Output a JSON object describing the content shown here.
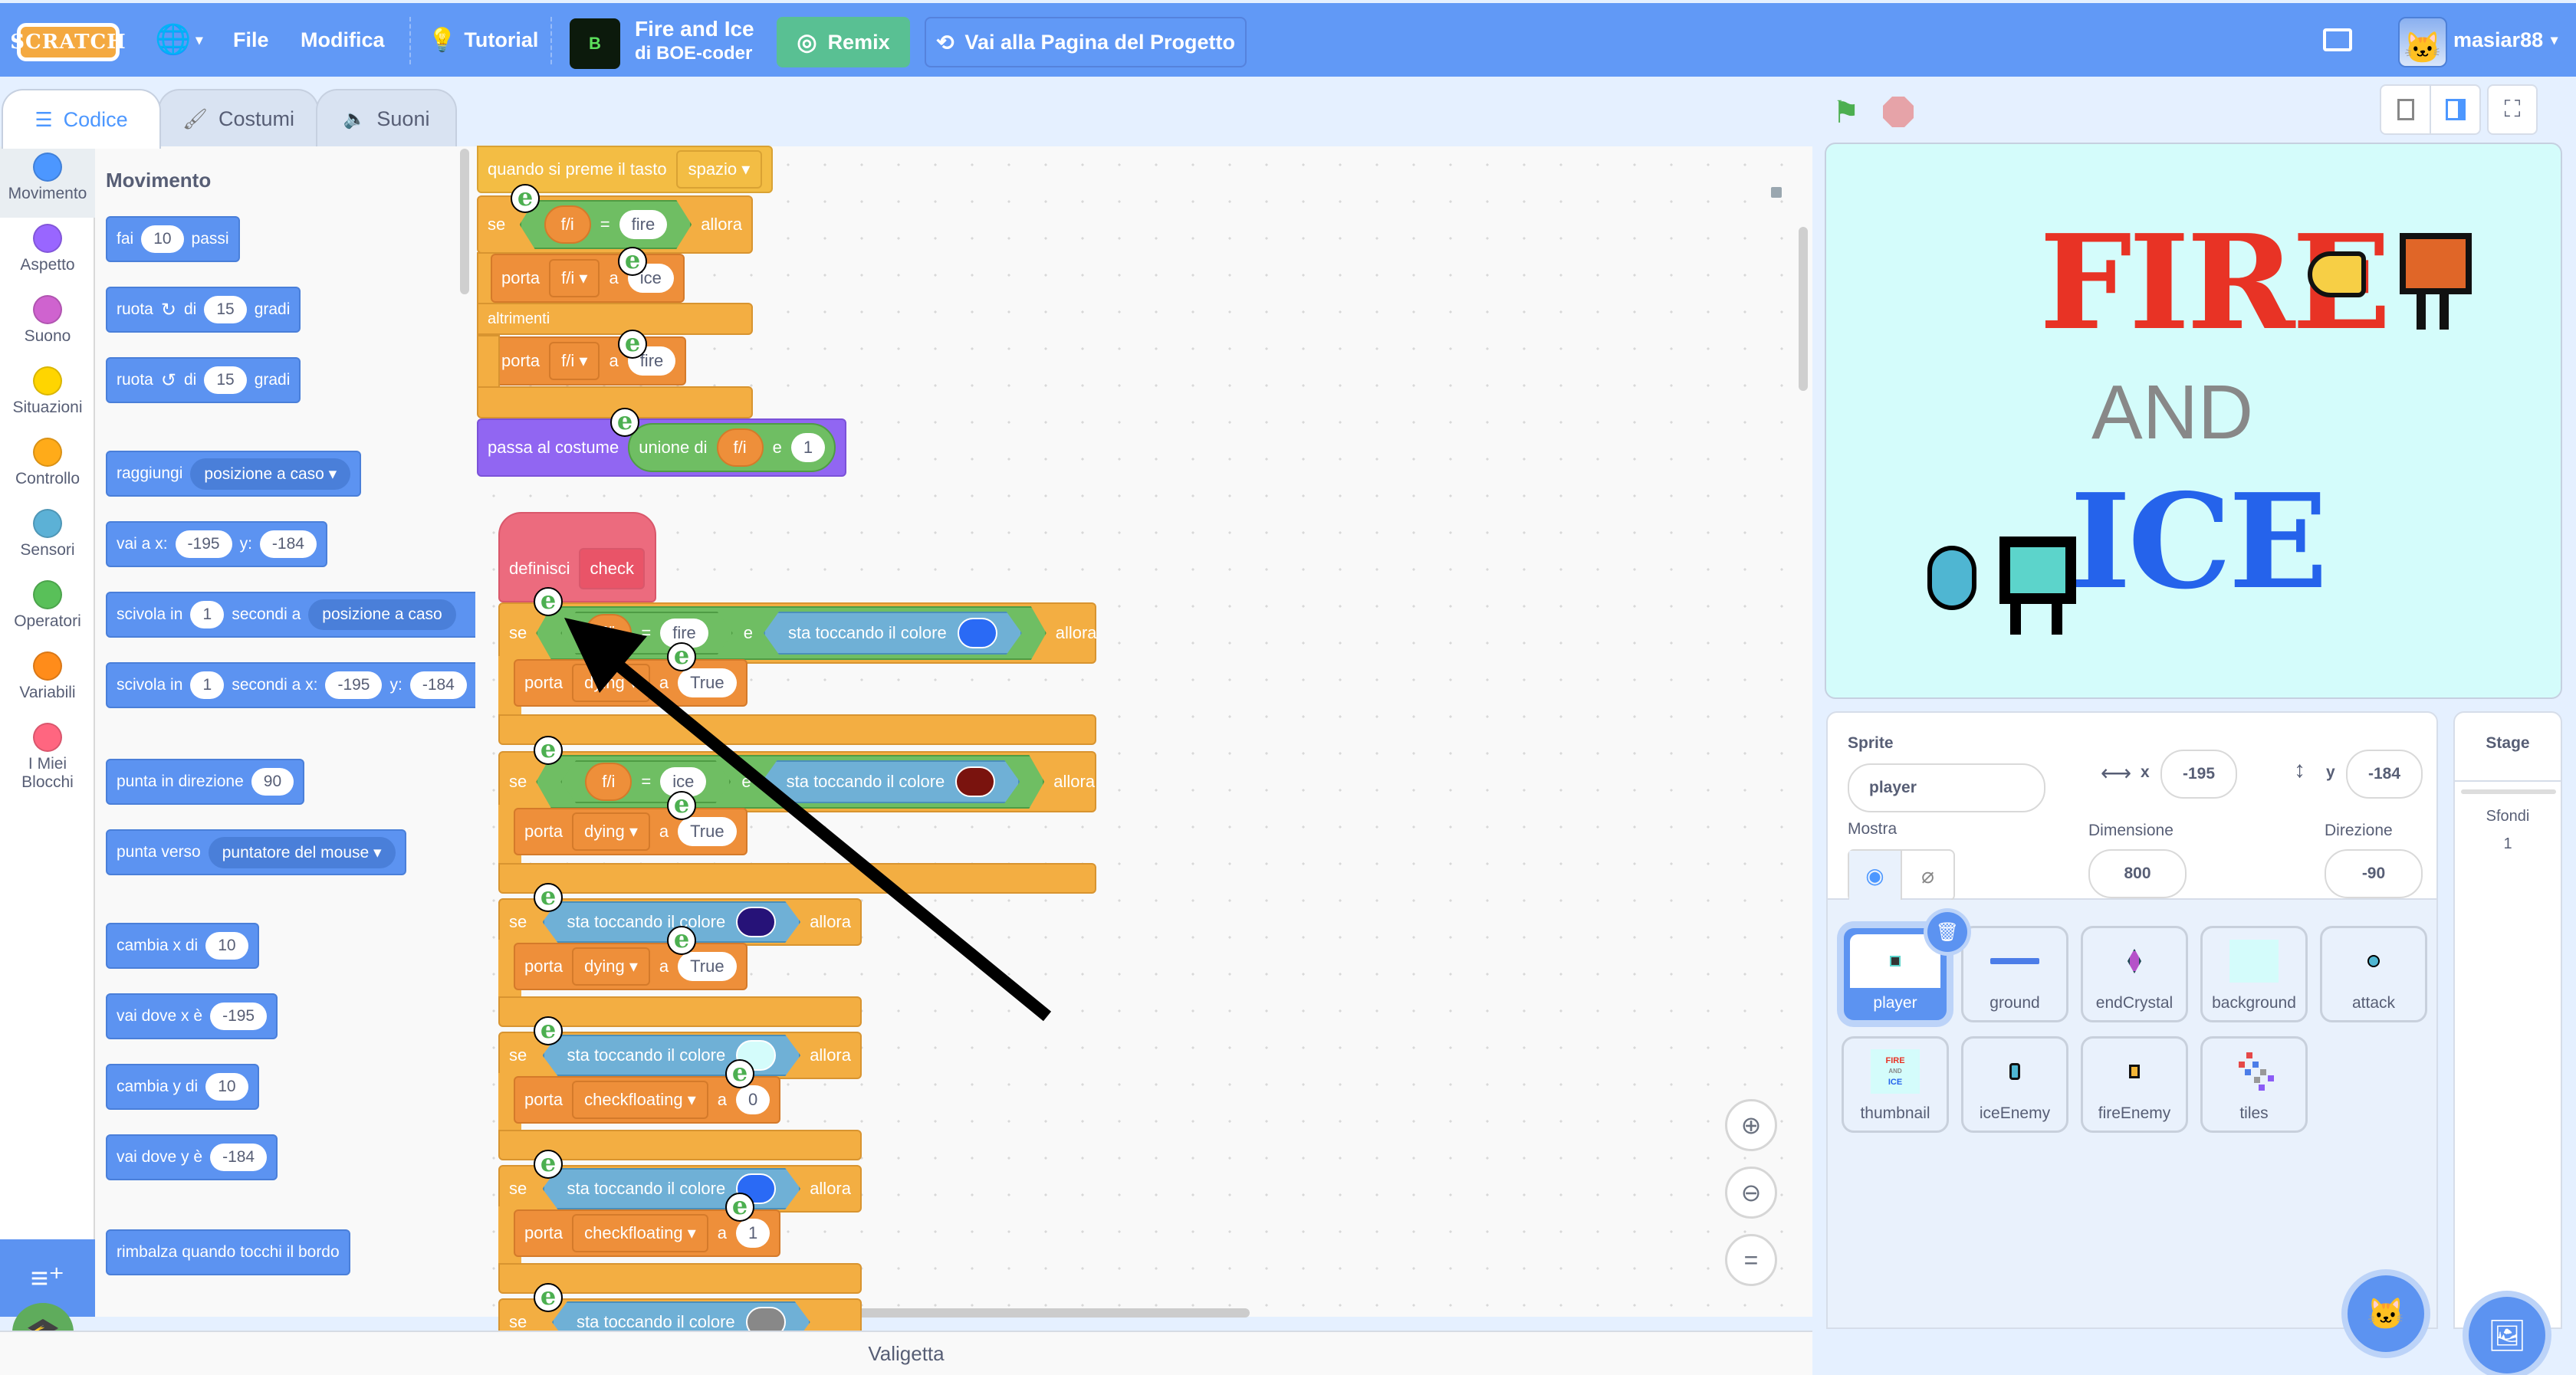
{
  "menubar": {
    "logo": "SCRATCH",
    "language_icon": "globe-icon",
    "file": "File",
    "edit": "Modifica",
    "tutorial": "Tutorial",
    "project_thumb_letter": "B",
    "project_title": "Fire and Ice",
    "project_author": "di BOE-coder",
    "remix": "Remix",
    "project_page": "Vai alla Pagina del Progetto",
    "username": "masiar88"
  },
  "tabs": {
    "code": "Codice",
    "costumes": "Costumi",
    "sounds": "Suoni"
  },
  "categories": [
    {
      "label": "Movimento",
      "color": "#4c97ff"
    },
    {
      "label": "Aspetto",
      "color": "#9966ff"
    },
    {
      "label": "Suono",
      "color": "#cf63cf"
    },
    {
      "label": "Situazioni",
      "color": "#ffd500"
    },
    {
      "label": "Controllo",
      "color": "#ffab19"
    },
    {
      "label": "Sensori",
      "color": "#5cb1d6"
    },
    {
      "label": "Operatori",
      "color": "#59c059"
    },
    {
      "label": "Variabili",
      "color": "#ff8c1a"
    },
    {
      "label": "I Miei Blocchi",
      "color": "#ff6680"
    }
  ],
  "palette": {
    "title": "Movimento",
    "blocks": {
      "move": {
        "pre": "fai",
        "val": "10",
        "post": "passi"
      },
      "turn_right": {
        "pre": "ruota",
        "mid": "di",
        "val": "15",
        "post": "gradi"
      },
      "turn_left": {
        "pre": "ruota",
        "mid": "di",
        "val": "15",
        "post": "gradi"
      },
      "goto": {
        "pre": "raggiungi",
        "dd": "posizione a caso"
      },
      "goto_xy": {
        "pre": "vai a x:",
        "x": "-195",
        "ylbl": "y:",
        "y": "-184"
      },
      "glide": {
        "pre": "scivola in",
        "val": "1",
        "mid": "secondi a",
        "dd": "posizione a caso"
      },
      "glide_xy": {
        "pre": "scivola in",
        "val": "1",
        "mid": "secondi a x:",
        "x": "-195",
        "ylbl": "y:",
        "y": "-184"
      },
      "point_dir": {
        "pre": "punta in direzione",
        "val": "90"
      },
      "point_towards": {
        "pre": "punta verso",
        "dd": "puntatore del mouse"
      },
      "change_x": {
        "pre": "cambia x di",
        "val": "10"
      },
      "set_x": {
        "pre": "vai dove x è",
        "val": "-195"
      },
      "change_y": {
        "pre": "cambia y di",
        "val": "10"
      },
      "set_y": {
        "pre": "vai dove y è",
        "val": "-184"
      },
      "bounce": {
        "pre": "rimbalza quando tocchi il bordo"
      }
    }
  },
  "script1": {
    "hat": {
      "label": "quando si preme il tasto",
      "key": "spazio"
    },
    "if": {
      "se": "se",
      "var": "f/i",
      "eq": "=",
      "val": "fire",
      "then": "allora"
    },
    "set1": {
      "porta": "porta",
      "var": "f/i",
      "a": "a",
      "val": "ice"
    },
    "else": "altrimenti",
    "set2": {
      "porta": "porta",
      "var": "f/i",
      "a": "a",
      "val": "fire"
    },
    "costume": {
      "label": "passa al costume",
      "join": "unione di",
      "var": "f/i",
      "e": "e",
      "val": "1"
    }
  },
  "script2": {
    "define": {
      "label": "definisci",
      "name": "check"
    },
    "if1": {
      "se": "se",
      "var": "f/i",
      "eq": "=",
      "val": "fire",
      "and": "e",
      "touch": "sta toccando il colore",
      "color": "#2a6af5",
      "then": "allora"
    },
    "set1": {
      "porta": "porta",
      "var": "dying",
      "a": "a",
      "val": "True"
    },
    "if2": {
      "se": "se",
      "var": "f/i",
      "eq": "=",
      "val": "ice",
      "and": "e",
      "touch": "sta toccando il colore",
      "color": "#7a130e",
      "then": "allora"
    },
    "set2": {
      "porta": "porta",
      "var": "dying",
      "a": "a",
      "val": "True"
    },
    "if3": {
      "se": "se",
      "touch": "sta toccando il colore",
      "color": "#261278",
      "then": "allora"
    },
    "set3": {
      "porta": "porta",
      "var": "dying",
      "a": "a",
      "val": "True"
    },
    "if4": {
      "se": "se",
      "touch": "sta toccando il colore",
      "color": "#d4fcfb",
      "then": "allora"
    },
    "set4": {
      "porta": "porta",
      "var": "checkfloating",
      "a": "a",
      "val": "0"
    },
    "if5": {
      "se": "se",
      "touch": "sta toccando il colore",
      "color": "#2a6af5",
      "then": "allora"
    },
    "set5": {
      "porta": "porta",
      "var": "checkfloating",
      "a": "a",
      "val": "1"
    },
    "if6": {
      "se": "se",
      "touch": "sta toccando il colore",
      "color": "#888888"
    }
  },
  "badge_letter": "e",
  "workspace": {
    "zoom_in": "zoom-in",
    "zoom_out": "zoom-out",
    "reset": "="
  },
  "backpack": "Valigetta",
  "stage_display": {
    "line1": "FIRE",
    "line2": "AND",
    "line3": "ICE"
  },
  "sprite_info": {
    "sprite_label": "Sprite",
    "sprite_name": "player",
    "x_label": "x",
    "x": "-195",
    "y_label": "y",
    "y": "-184",
    "show_label": "Mostra",
    "size_label": "Dimensione",
    "size": "800",
    "direction_label": "Direzione",
    "direction": "-90"
  },
  "sprites": [
    {
      "name": "player",
      "selected": true
    },
    {
      "name": "ground"
    },
    {
      "name": "endCrystal"
    },
    {
      "name": "background"
    },
    {
      "name": "attack"
    },
    {
      "name": "thumbnail"
    },
    {
      "name": "iceEnemy"
    },
    {
      "name": "fireEnemy"
    },
    {
      "name": "tiles"
    }
  ],
  "stage_pane": {
    "title": "Stage",
    "backdrops_label": "Sfondi",
    "backdrops_count": "1"
  }
}
